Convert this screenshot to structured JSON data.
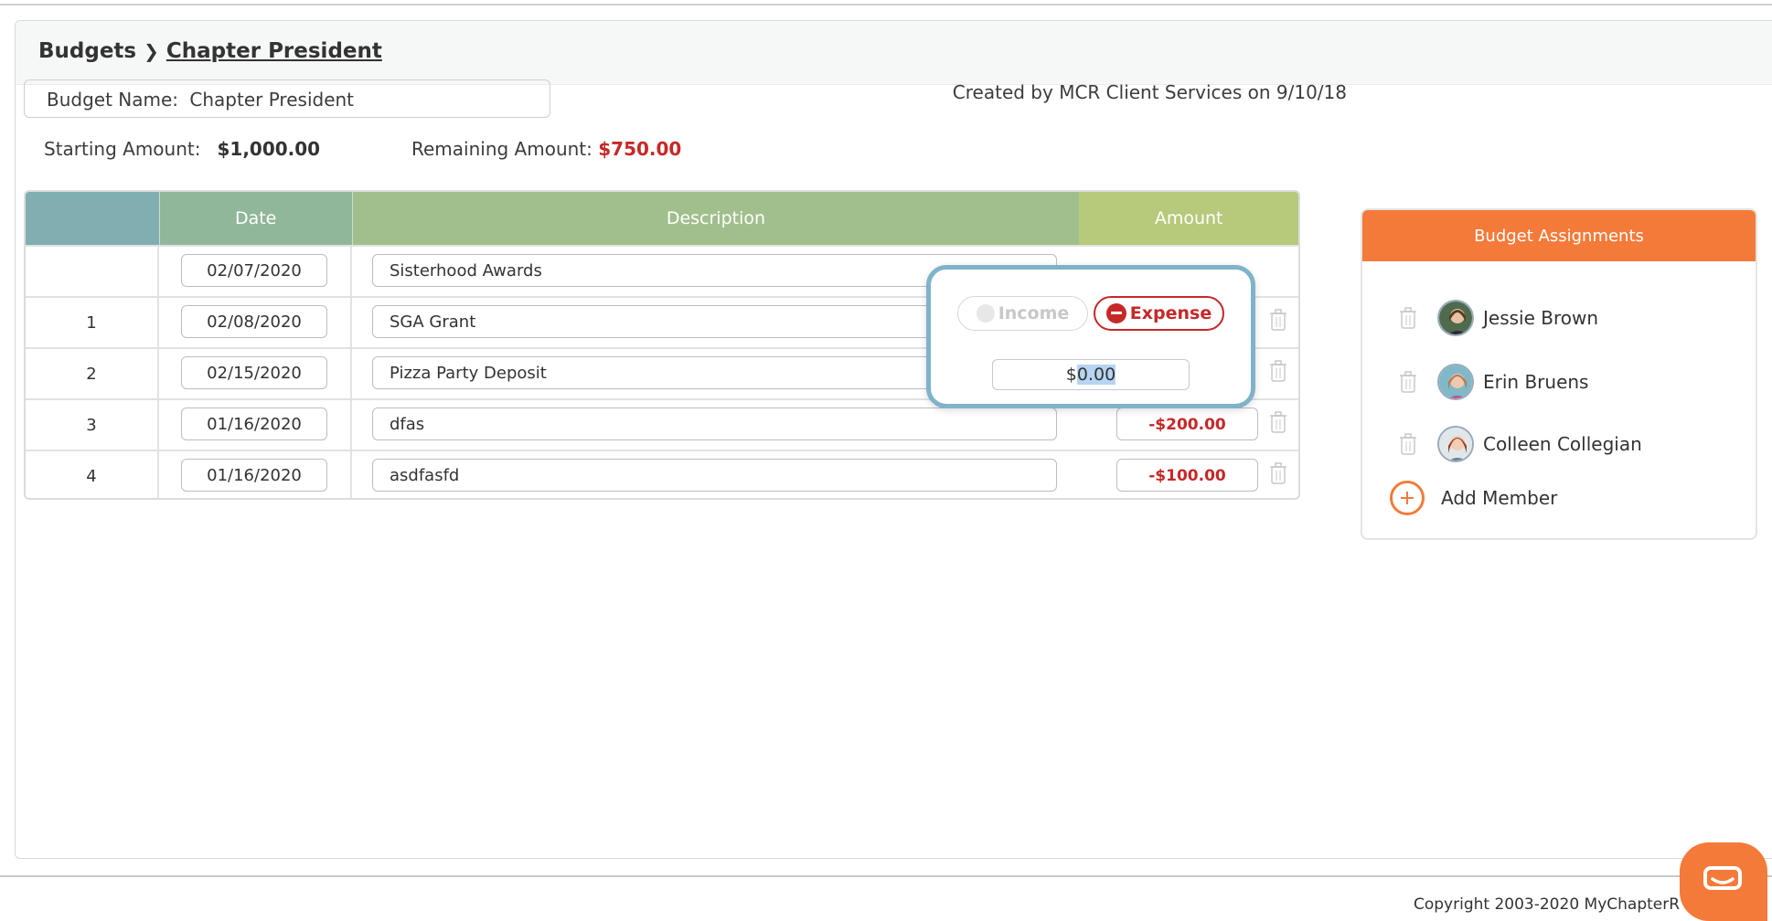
{
  "breadcrumb": {
    "root": "Budgets",
    "separator": "❯",
    "current": "Chapter President"
  },
  "budget": {
    "name_label": "Budget Name:",
    "name_value": "Chapter President",
    "created_by": "Created by MCR Client Services on 9/10/18",
    "starting_label": "Starting Amount:",
    "starting_amount": "$1,000.00",
    "remaining_label": "Remaining Amount:",
    "remaining_amount": "$750.00"
  },
  "table": {
    "headers": {
      "date": "Date",
      "description": "Description",
      "amount": "Amount"
    },
    "rows": [
      {
        "index": "",
        "date": "02/07/2020",
        "description": "Sisterhood Awards",
        "amount": ""
      },
      {
        "index": "1",
        "date": "02/08/2020",
        "description": "SGA Grant",
        "amount": ""
      },
      {
        "index": "2",
        "date": "02/15/2020",
        "description": "Pizza Party Deposit",
        "amount": ""
      },
      {
        "index": "3",
        "date": "01/16/2020",
        "description": "dfas",
        "amount": "-$200.00"
      },
      {
        "index": "4",
        "date": "01/16/2020",
        "description": "asdfasfd",
        "amount": "-$100.00"
      }
    ]
  },
  "popover": {
    "income_label": "Income",
    "expense_label": "Expense",
    "amount_prefix": "$",
    "amount_selected": "0.00"
  },
  "assignments": {
    "title": "Budget Assignments",
    "members": [
      {
        "name": "Jessie Brown"
      },
      {
        "name": "Erin Bruens"
      },
      {
        "name": "Colleen Collegian"
      }
    ],
    "add_label": "Add Member"
  },
  "footer": {
    "copyright": "Copyright 2003-2020 MyChapterR"
  },
  "colors": {
    "accent": "#f47a3a",
    "negative": "#c62828",
    "popover_border": "#7fb3c9",
    "header_idx": "#81aeb0",
    "header_date": "#91b79a",
    "header_desc": "#a1bf8c",
    "header_amount": "#b7c97a"
  },
  "icons": {
    "trash": "trash-icon",
    "chat": "chat-icon",
    "add": "plus-circle-icon"
  }
}
